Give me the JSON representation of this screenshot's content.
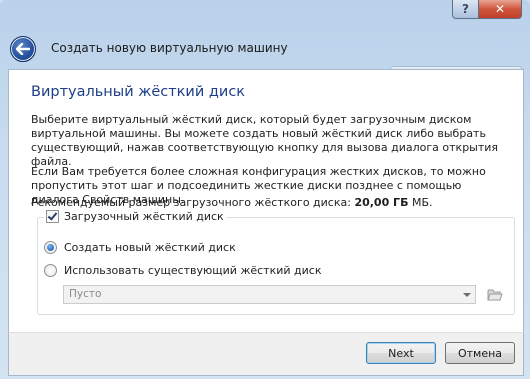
{
  "window": {
    "title": "Создать новую виртуальную машину",
    "help_glyph": "?",
    "close_glyph": "✕"
  },
  "page": {
    "heading": "Виртуальный жёсткий диск",
    "para1": "Выберите виртуальный жёсткий диск, который будет загрузочным диском виртуальной машины. Вы можете создать новый жёсткий диск либо выбрать существующий, нажав соответствующую кнопку для вызова диалога открытия файла.",
    "para2": "Если Вам требуется более сложная конфигурация жестких дисков, то можно пропустить этот шаг и подсоединить жесткие диски позднее с помощью диалога Свойств машины.",
    "recommended_prefix": "Рекомендуемый размер загрузочного жёсткого диска: ",
    "recommended_value": "20,00 ГБ",
    "recommended_suffix": " МБ."
  },
  "boot_disk": {
    "checkbox_label": "Загрузочный жёсткий диск",
    "checked": true,
    "option_new": "Создать новый жёсткий диск",
    "option_existing": "Использовать существующий жёсткий диск",
    "selected_option": "new",
    "combo_value": "Пусто",
    "combo_enabled": false
  },
  "icons": {
    "back": "back-arrow-icon",
    "folder": "folder-open-icon",
    "combo_arrow": "chevron-down-icon"
  },
  "buttons": {
    "next": "Next",
    "cancel": "Отмена"
  },
  "colors": {
    "heading": "#1e3f87",
    "frame": "#c9dcef",
    "close": "#c0402a"
  }
}
